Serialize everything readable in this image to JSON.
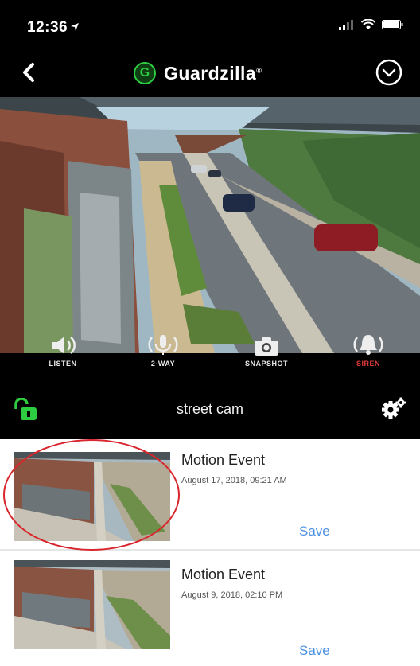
{
  "status_bar": {
    "time": "12:36"
  },
  "app": {
    "logo_letter": "G",
    "name": "Guardzilla",
    "trademark": "®"
  },
  "controls": [
    {
      "label": "LISTEN",
      "icon": "speaker-icon"
    },
    {
      "label": "2-WAY",
      "icon": "microphone-icon"
    },
    {
      "label": "SNAPSHOT",
      "icon": "camera-icon"
    },
    {
      "label": "SIREN",
      "icon": "bell-icon"
    }
  ],
  "camera": {
    "name": "street cam"
  },
  "events": [
    {
      "title": "Motion Event",
      "date": "August 17, 2018, 09:21 AM",
      "save_label": "Save"
    },
    {
      "title": "Motion Event",
      "date": "August 9, 2018, 02:10 PM",
      "save_label": "Save"
    }
  ],
  "colors": {
    "accent_green": "#2ecc40",
    "link_blue": "#4a90e2",
    "siren_red": "#e03a3a",
    "highlight_red": "#d9262c"
  }
}
